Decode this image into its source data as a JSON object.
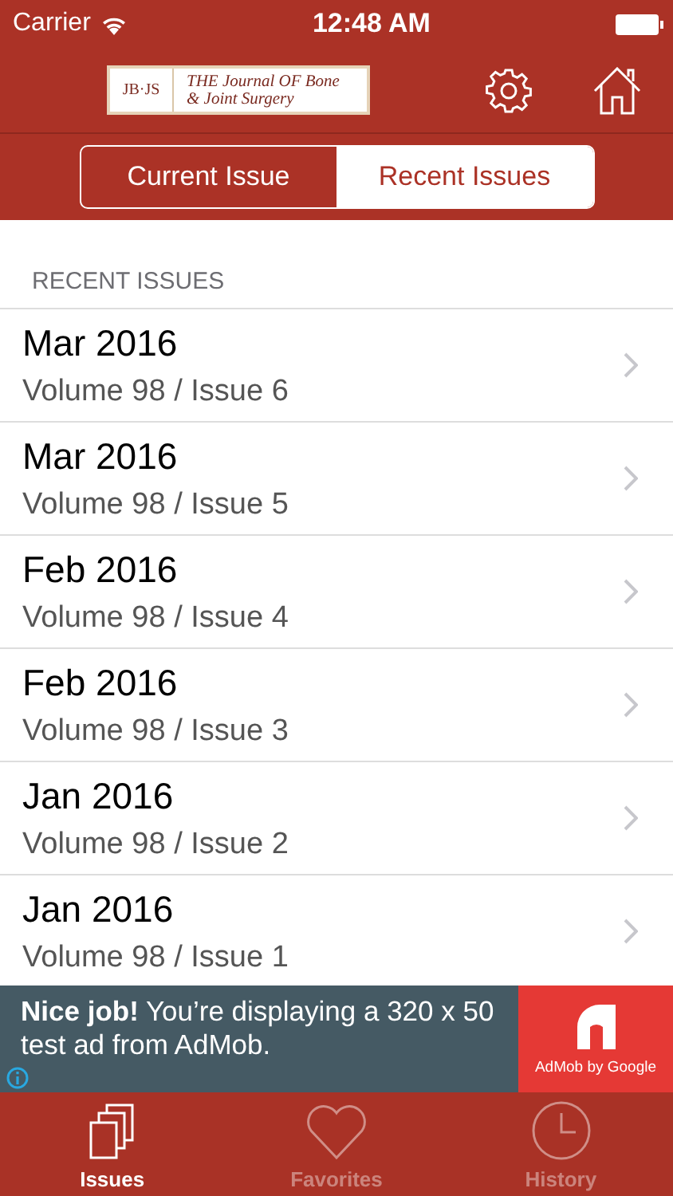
{
  "status_bar": {
    "carrier": "Carrier",
    "time": "12:48 AM"
  },
  "header": {
    "logo": {
      "mark": "JB·JS",
      "line_1": "THE Journal OF Bone",
      "line_2": "& Joint Surgery"
    }
  },
  "segments": [
    {
      "label": "Current Issue",
      "selected": false
    },
    {
      "label": "Recent Issues",
      "selected": true
    }
  ],
  "list": {
    "heading": "RECENT ISSUES",
    "rows": [
      {
        "date": "Mar 2016",
        "volume": "Volume 98 / Issue 6"
      },
      {
        "date": "Mar 2016",
        "volume": "Volume 98 / Issue 5"
      },
      {
        "date": "Feb 2016",
        "volume": "Volume 98 / Issue 4"
      },
      {
        "date": "Feb 2016",
        "volume": "Volume 98 / Issue 3"
      },
      {
        "date": "Jan 2016",
        "volume": "Volume 98 / Issue 2"
      },
      {
        "date": "Jan 2016",
        "volume": "Volume 98 / Issue 1"
      }
    ]
  },
  "ad": {
    "message": "**Nice job!** You’re displaying a 320 x 50 test ad from AdMob.",
    "brand": "AdMob by Google"
  },
  "tab_bar": [
    {
      "label": "Issues",
      "kind": "issues",
      "selected": true
    },
    {
      "label": "Favorites",
      "kind": "favorites",
      "selected": false
    },
    {
      "label": "History",
      "kind": "history",
      "selected": false
    }
  ]
}
